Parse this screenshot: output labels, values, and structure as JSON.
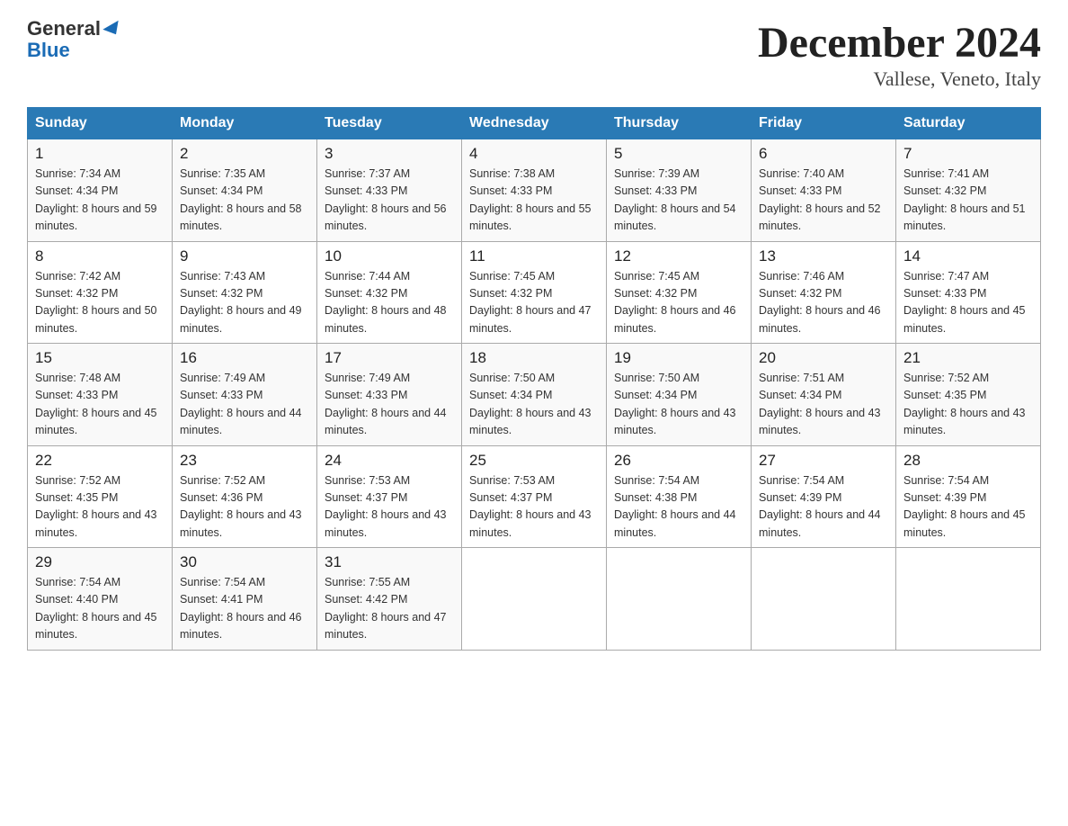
{
  "header": {
    "logo_general": "General",
    "logo_blue": "Blue",
    "title": "December 2024",
    "subtitle": "Vallese, Veneto, Italy"
  },
  "columns": [
    "Sunday",
    "Monday",
    "Tuesday",
    "Wednesday",
    "Thursday",
    "Friday",
    "Saturday"
  ],
  "weeks": [
    [
      {
        "day": "1",
        "sunrise": "7:34 AM",
        "sunset": "4:34 PM",
        "daylight": "8 hours and 59 minutes."
      },
      {
        "day": "2",
        "sunrise": "7:35 AM",
        "sunset": "4:34 PM",
        "daylight": "8 hours and 58 minutes."
      },
      {
        "day": "3",
        "sunrise": "7:37 AM",
        "sunset": "4:33 PM",
        "daylight": "8 hours and 56 minutes."
      },
      {
        "day": "4",
        "sunrise": "7:38 AM",
        "sunset": "4:33 PM",
        "daylight": "8 hours and 55 minutes."
      },
      {
        "day": "5",
        "sunrise": "7:39 AM",
        "sunset": "4:33 PM",
        "daylight": "8 hours and 54 minutes."
      },
      {
        "day": "6",
        "sunrise": "7:40 AM",
        "sunset": "4:33 PM",
        "daylight": "8 hours and 52 minutes."
      },
      {
        "day": "7",
        "sunrise": "7:41 AM",
        "sunset": "4:32 PM",
        "daylight": "8 hours and 51 minutes."
      }
    ],
    [
      {
        "day": "8",
        "sunrise": "7:42 AM",
        "sunset": "4:32 PM",
        "daylight": "8 hours and 50 minutes."
      },
      {
        "day": "9",
        "sunrise": "7:43 AM",
        "sunset": "4:32 PM",
        "daylight": "8 hours and 49 minutes."
      },
      {
        "day": "10",
        "sunrise": "7:44 AM",
        "sunset": "4:32 PM",
        "daylight": "8 hours and 48 minutes."
      },
      {
        "day": "11",
        "sunrise": "7:45 AM",
        "sunset": "4:32 PM",
        "daylight": "8 hours and 47 minutes."
      },
      {
        "day": "12",
        "sunrise": "7:45 AM",
        "sunset": "4:32 PM",
        "daylight": "8 hours and 46 minutes."
      },
      {
        "day": "13",
        "sunrise": "7:46 AM",
        "sunset": "4:32 PM",
        "daylight": "8 hours and 46 minutes."
      },
      {
        "day": "14",
        "sunrise": "7:47 AM",
        "sunset": "4:33 PM",
        "daylight": "8 hours and 45 minutes."
      }
    ],
    [
      {
        "day": "15",
        "sunrise": "7:48 AM",
        "sunset": "4:33 PM",
        "daylight": "8 hours and 45 minutes."
      },
      {
        "day": "16",
        "sunrise": "7:49 AM",
        "sunset": "4:33 PM",
        "daylight": "8 hours and 44 minutes."
      },
      {
        "day": "17",
        "sunrise": "7:49 AM",
        "sunset": "4:33 PM",
        "daylight": "8 hours and 44 minutes."
      },
      {
        "day": "18",
        "sunrise": "7:50 AM",
        "sunset": "4:34 PM",
        "daylight": "8 hours and 43 minutes."
      },
      {
        "day": "19",
        "sunrise": "7:50 AM",
        "sunset": "4:34 PM",
        "daylight": "8 hours and 43 minutes."
      },
      {
        "day": "20",
        "sunrise": "7:51 AM",
        "sunset": "4:34 PM",
        "daylight": "8 hours and 43 minutes."
      },
      {
        "day": "21",
        "sunrise": "7:52 AM",
        "sunset": "4:35 PM",
        "daylight": "8 hours and 43 minutes."
      }
    ],
    [
      {
        "day": "22",
        "sunrise": "7:52 AM",
        "sunset": "4:35 PM",
        "daylight": "8 hours and 43 minutes."
      },
      {
        "day": "23",
        "sunrise": "7:52 AM",
        "sunset": "4:36 PM",
        "daylight": "8 hours and 43 minutes."
      },
      {
        "day": "24",
        "sunrise": "7:53 AM",
        "sunset": "4:37 PM",
        "daylight": "8 hours and 43 minutes."
      },
      {
        "day": "25",
        "sunrise": "7:53 AM",
        "sunset": "4:37 PM",
        "daylight": "8 hours and 43 minutes."
      },
      {
        "day": "26",
        "sunrise": "7:54 AM",
        "sunset": "4:38 PM",
        "daylight": "8 hours and 44 minutes."
      },
      {
        "day": "27",
        "sunrise": "7:54 AM",
        "sunset": "4:39 PM",
        "daylight": "8 hours and 44 minutes."
      },
      {
        "day": "28",
        "sunrise": "7:54 AM",
        "sunset": "4:39 PM",
        "daylight": "8 hours and 45 minutes."
      }
    ],
    [
      {
        "day": "29",
        "sunrise": "7:54 AM",
        "sunset": "4:40 PM",
        "daylight": "8 hours and 45 minutes."
      },
      {
        "day": "30",
        "sunrise": "7:54 AM",
        "sunset": "4:41 PM",
        "daylight": "8 hours and 46 minutes."
      },
      {
        "day": "31",
        "sunrise": "7:55 AM",
        "sunset": "4:42 PM",
        "daylight": "8 hours and 47 minutes."
      },
      null,
      null,
      null,
      null
    ]
  ]
}
